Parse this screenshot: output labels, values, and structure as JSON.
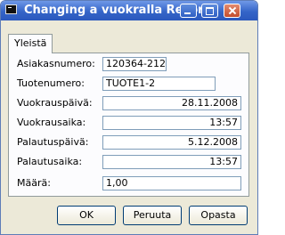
{
  "window": {
    "title": "Changing a vuokralla Record"
  },
  "tabs": [
    {
      "label": "Yleistä"
    }
  ],
  "fields": {
    "asiakasnumero": {
      "label": "Asiakasnumero:",
      "value": "120364-212"
    },
    "tuotenumero": {
      "label": "Tuotenumero:",
      "value": "TUOTE1-2"
    },
    "vuokrauspaiva": {
      "label": "Vuokrauspäivä:",
      "value": "28.11.2008"
    },
    "vuokrausaika": {
      "label": "Vuokrausaika:",
      "value": "13:57"
    },
    "palautuspaiva": {
      "label": "Palautuspäivä:",
      "value": "5.12.2008"
    },
    "palautusaika": {
      "label": "Palautusaika:",
      "value": "13:57"
    },
    "maara": {
      "label": "Määrä:",
      "value": "1,00"
    }
  },
  "buttons": {
    "ok": "OK",
    "cancel": "Peruuta",
    "help": "Opasta"
  }
}
